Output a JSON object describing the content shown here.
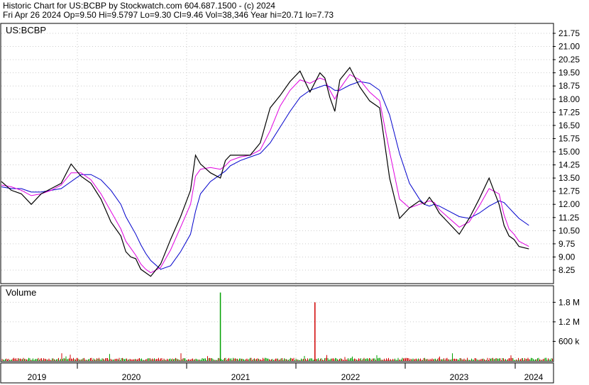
{
  "header": {
    "line1": "Historic Chart for US:BCBP by Stockwatch.com 604.687.1500 - (c) 2024",
    "line2": "Fri Apr 26 2024    Op=9.50    Hi=9.5797    Lo=9.30    Cl=9.46    Vol=38,346    Year hi=20.71    lo=7.73"
  },
  "colors": {
    "price": "#000000",
    "ma_short": "#e000e0",
    "ma_long": "#0000cc",
    "volume_up": "#00a000",
    "volume_down": "#d00000",
    "grid": "#cccccc",
    "border": "#000000"
  },
  "chart_data": [
    {
      "type": "line",
      "title": "US:BCBP",
      "ylim": [
        7.73,
        22.0
      ],
      "y_ticks": [
        "21.75",
        "21.00",
        "20.25",
        "19.50",
        "18.75",
        "18.00",
        "17.25",
        "16.50",
        "15.75",
        "15.00",
        "14.25",
        "13.50",
        "12.75",
        "12.00",
        "11.25",
        "10.50",
        "9.75",
        "9.00",
        "8.25"
      ],
      "x": [
        2018.8,
        2018.9,
        2019.0,
        2019.1,
        2019.2,
        2019.3,
        2019.4,
        2019.5,
        2019.6,
        2019.7,
        2019.8,
        2019.9,
        2020.0,
        2020.05,
        2020.1,
        2020.15,
        2020.2,
        2020.25,
        2020.3,
        2020.4,
        2020.5,
        2020.6,
        2020.7,
        2020.75,
        2020.8,
        2020.9,
        2021.0,
        2021.05,
        2021.1,
        2021.2,
        2021.3,
        2021.4,
        2021.5,
        2021.6,
        2021.7,
        2021.8,
        2021.9,
        2022.0,
        2022.05,
        2022.1,
        2022.15,
        2022.2,
        2022.3,
        2022.4,
        2022.5,
        2022.6,
        2022.7,
        2022.8,
        2022.9,
        2023.0,
        2023.05,
        2023.1,
        2023.15,
        2023.2,
        2023.3,
        2023.4,
        2023.5,
        2023.6,
        2023.7,
        2023.8,
        2023.85,
        2023.9,
        2023.95,
        2024.0,
        2024.1,
        2024.2,
        2024.3
      ],
      "series": [
        {
          "values": [
            13.3,
            12.8,
            12.6,
            12.0,
            12.6,
            12.9,
            13.2,
            14.3,
            13.6,
            13.2,
            12.3,
            11.0,
            10.2,
            9.3,
            9.0,
            8.9,
            8.3,
            8.1,
            7.9,
            8.6,
            10.0,
            11.3,
            12.8,
            14.8,
            14.3,
            13.8,
            13.5,
            14.5,
            14.8,
            14.8,
            14.8,
            15.5,
            17.5,
            18.2,
            19.0,
            19.6,
            18.4,
            19.5,
            19.2,
            18.1,
            17.3,
            19.1,
            19.8,
            18.7,
            17.9,
            17.5,
            13.5,
            11.2,
            11.8,
            12.2,
            12.0,
            12.4,
            12.0,
            11.5,
            10.9,
            10.3,
            11.2,
            12.3,
            13.5,
            12.0,
            10.8,
            10.2,
            10.0,
            9.6,
            9.46
          ]
        },
        {
          "values": [
            13.1,
            13.0,
            12.8,
            12.5,
            12.6,
            12.8,
            13.1,
            13.8,
            13.8,
            13.4,
            12.6,
            11.6,
            10.6,
            9.9,
            9.5,
            9.1,
            8.6,
            8.3,
            8.1,
            8.4,
            9.4,
            10.7,
            12.0,
            13.6,
            14.0,
            14.1,
            14.0,
            14.2,
            14.5,
            14.7,
            14.8,
            15.1,
            16.2,
            17.6,
            18.5,
            19.1,
            18.9,
            19.2,
            19.1,
            18.5,
            18.0,
            18.6,
            19.4,
            19.1,
            18.4,
            17.9,
            15.0,
            12.3,
            11.8,
            12.0,
            12.1,
            12.2,
            12.1,
            11.7,
            11.2,
            10.7,
            11.0,
            11.9,
            12.9,
            12.6,
            11.4,
            10.6,
            10.3,
            9.9,
            9.6
          ]
        },
        {
          "values": [
            13.0,
            12.9,
            12.9,
            12.7,
            12.7,
            12.8,
            12.9,
            13.3,
            13.7,
            13.7,
            13.4,
            12.8,
            12.0,
            11.3,
            10.8,
            10.3,
            9.7,
            9.2,
            8.8,
            8.3,
            8.5,
            9.3,
            10.3,
            11.6,
            12.6,
            13.3,
            13.7,
            13.9,
            14.2,
            14.5,
            14.7,
            14.9,
            15.5,
            16.4,
            17.3,
            18.1,
            18.5,
            18.7,
            18.8,
            18.7,
            18.5,
            18.5,
            18.8,
            19.0,
            18.9,
            18.5,
            17.1,
            14.9,
            13.2,
            12.3,
            12.0,
            11.9,
            12.0,
            11.9,
            11.6,
            11.3,
            11.2,
            11.5,
            11.9,
            12.2,
            12.1,
            11.8,
            11.5,
            11.2,
            10.8
          ]
        }
      ]
    },
    {
      "type": "bar",
      "title": "Volume",
      "y_ticks": [
        "1.8 M",
        "1.2 M",
        "600 k"
      ],
      "ylim": [
        0,
        2200000
      ],
      "x_ticks": [
        "2019",
        "2020",
        "2021",
        "2022",
        "2023",
        "2024"
      ],
      "spikes": [
        {
          "x": 2021.0,
          "value": 2100000,
          "direction": "up"
        },
        {
          "x": 2021.95,
          "value": 1800000,
          "direction": "down"
        }
      ],
      "baseline_volume": 60000
    }
  ]
}
